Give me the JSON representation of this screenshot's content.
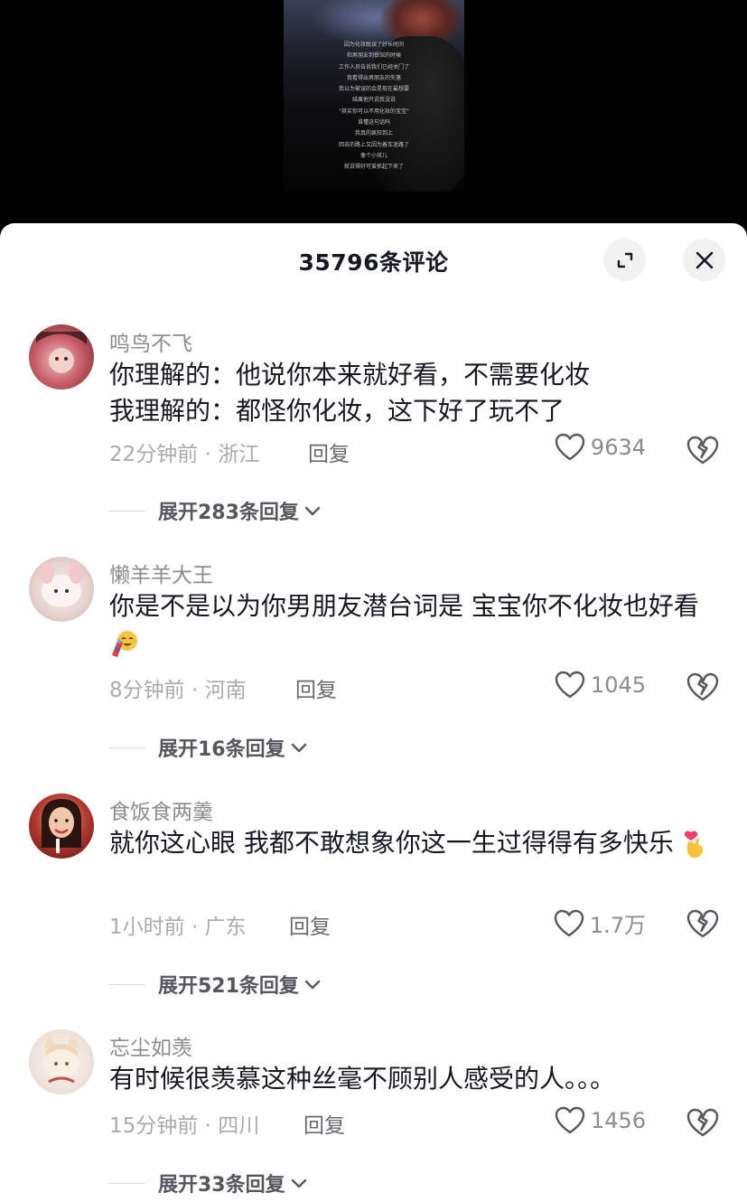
{
  "video": {
    "overlay_lines": [
      "因为化妆耽误了好长时间",
      "和男朋友到餐馆的时候",
      "工作人员告诉我们已经关门了",
      "我看得出男朋友的失落",
      "我以为被误的会是现在最想要",
      "结果他只说我没说",
      "\"其实你可以不用化妆的宝宝\"",
      "谁懂这句话吗",
      "我真的疯狂到上",
      "回去的路上又因为着车迷路了",
      "像个小孩儿",
      "就说得好可爱抓起下来了"
    ]
  },
  "sheet": {
    "title": "35796条评论",
    "expand_icon": "expand-icon",
    "close_icon": "close-icon"
  },
  "comments": [
    {
      "username": "鸣鸟不飞",
      "text": "你理解的：他说你本来就好看，不需要化妆\n我理解的：都怪你化妆，这下好了玩不了",
      "meta": "22分钟前 · 浙江",
      "reply_label": "回复",
      "likes": "9634",
      "expand_label": "展开283条回复",
      "avatar_color": "#c9606a"
    },
    {
      "username": "懒羊羊大王",
      "text": "你是不是以为你男朋友潜台词是 宝宝你不化妆也好看",
      "meta": "8分钟前 · 河南",
      "reply_label": "回复",
      "likes": "1045",
      "expand_label": "展开16条回复",
      "avatar_color": "#eadad6"
    },
    {
      "username": "食饭食两羹",
      "text": "就你这心眼 我都不敢想象你这一生过得得有多快乐",
      "meta": "1小时前 · 广东",
      "reply_label": "回复",
      "likes": "1.7万",
      "expand_label": "展开521条回复",
      "avatar_color": "#a32a2a"
    },
    {
      "username": "忘尘如羡",
      "text": "有时候很羡慕这种丝毫不顾别人感受的人。。。",
      "meta": "15分钟前 · 四川",
      "reply_label": "回复",
      "likes": "1456",
      "expand_label": "展开33条回复",
      "avatar_color": "#efe4dc"
    }
  ],
  "colors": {
    "text_primary": "#161823",
    "text_secondary": "#8a8b91",
    "icon": "#56575e"
  }
}
